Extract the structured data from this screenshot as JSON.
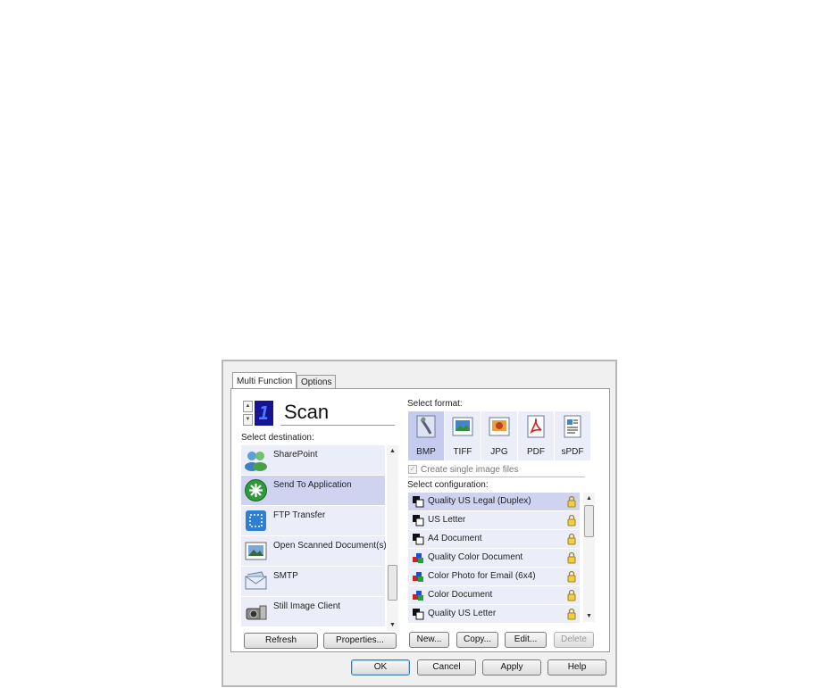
{
  "tabs": [
    "Multi Function",
    "Options"
  ],
  "counter": {
    "value": "1",
    "up_label": "▲",
    "down_label": "▼"
  },
  "title": "Scan",
  "labels": {
    "select_destination": "Select destination:",
    "select_format": "Select format:",
    "create_single": "Create single image files",
    "select_configuration": "Select configuration:"
  },
  "destinations": [
    {
      "label": "SharePoint",
      "icon": "sharepoint-icon",
      "selected": false
    },
    {
      "label": "Send To Application",
      "icon": "send-to-application-icon",
      "selected": true
    },
    {
      "label": "FTP Transfer",
      "icon": "ftp-transfer-icon",
      "selected": false
    },
    {
      "label": "Open Scanned Document(s)",
      "icon": "open-document-icon",
      "selected": false
    },
    {
      "label": "SMTP",
      "icon": "smtp-envelope-icon",
      "selected": false
    },
    {
      "label": "Still Image Client",
      "icon": "still-image-client-icon",
      "selected": false
    }
  ],
  "formats": [
    {
      "label": "BMP",
      "icon": "bmp-format-icon",
      "selected": true
    },
    {
      "label": "TIFF",
      "icon": "tiff-format-icon",
      "selected": false
    },
    {
      "label": "JPG",
      "icon": "jpg-format-icon",
      "selected": false
    },
    {
      "label": "PDF",
      "icon": "pdf-format-icon",
      "selected": false
    },
    {
      "label": "sPDF",
      "icon": "spdf-format-icon",
      "selected": false
    }
  ],
  "create_single_checked": true,
  "configurations": [
    {
      "label": "Quality US Legal (Duplex)",
      "icon": "bw-config-icon",
      "selected": true
    },
    {
      "label": "US Letter",
      "icon": "bw-config-icon",
      "selected": false
    },
    {
      "label": "A4 Document",
      "icon": "bw-config-icon",
      "selected": false
    },
    {
      "label": "Quality Color Document",
      "icon": "color-config-icon",
      "selected": false
    },
    {
      "label": "Color Photo for Email (6x4)",
      "icon": "color-config-icon",
      "selected": false
    },
    {
      "label": "Color Document",
      "icon": "color-config-icon",
      "selected": false
    },
    {
      "label": "Quality US Letter",
      "icon": "bw-config-icon",
      "selected": false
    }
  ],
  "left_buttons": {
    "refresh": "Refresh",
    "properties": "Properties..."
  },
  "right_buttons": {
    "new": "New...",
    "copy": "Copy...",
    "edit": "Edit...",
    "delete": "Delete"
  },
  "footer_buttons": {
    "ok": "OK",
    "cancel": "Cancel",
    "apply": "Apply",
    "help": "Help"
  },
  "colors": {
    "selection": "#cfd3f0",
    "item_bg": "#ebedf8",
    "counter_bg": "#141494",
    "counter_fg": "#4a7cff"
  }
}
